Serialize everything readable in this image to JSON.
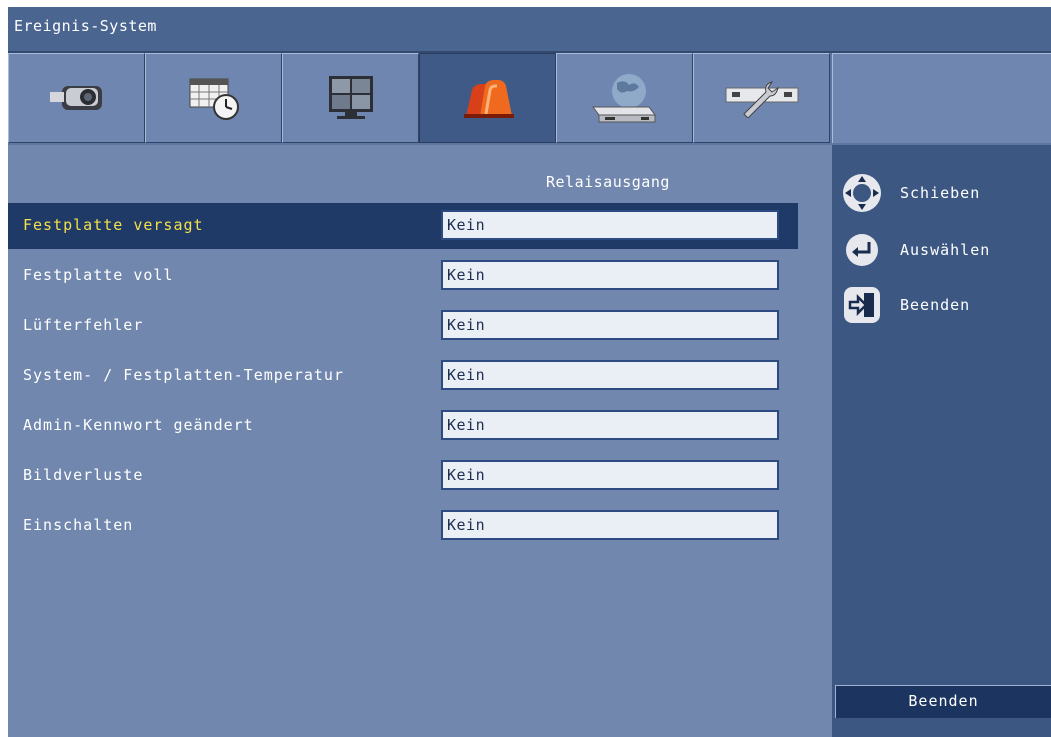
{
  "window": {
    "title": "Ereignis-System"
  },
  "tabs": [
    {
      "icon": "camera-icon",
      "active": false
    },
    {
      "icon": "schedule-icon",
      "active": false
    },
    {
      "icon": "monitor-icon",
      "active": false
    },
    {
      "icon": "alarm-icon",
      "active": true
    },
    {
      "icon": "network-icon",
      "active": false
    },
    {
      "icon": "tools-icon",
      "active": false
    }
  ],
  "main": {
    "column_header": "Relaisausgang",
    "rows": [
      {
        "label": "Festplatte versagt",
        "value": "Kein",
        "selected": true
      },
      {
        "label": "Festplatte voll",
        "value": "Kein",
        "selected": false
      },
      {
        "label": "Lüfterfehler",
        "value": "Kein",
        "selected": false
      },
      {
        "label": "System- / Festplatten-Temperatur",
        "value": "Kein",
        "selected": false
      },
      {
        "label": "Admin-Kennwort geändert",
        "value": "Kein",
        "selected": false
      },
      {
        "label": "Bildverluste",
        "value": "Kein",
        "selected": false
      },
      {
        "label": "Einschalten",
        "value": "Kein",
        "selected": false
      }
    ]
  },
  "sidebar": {
    "hints": [
      {
        "icon": "navigation-pad-icon",
        "label": "Schieben"
      },
      {
        "icon": "enter-icon",
        "label": "Auswählen"
      },
      {
        "icon": "exit-icon",
        "label": "Beenden"
      }
    ],
    "exit_button": "Beenden"
  },
  "colors": {
    "title_bar": "#4a6590",
    "panel": "#7187ae",
    "sidebar": "#3c5882",
    "selected_row": "#1f3a66",
    "selected_text": "#f4e04a"
  }
}
